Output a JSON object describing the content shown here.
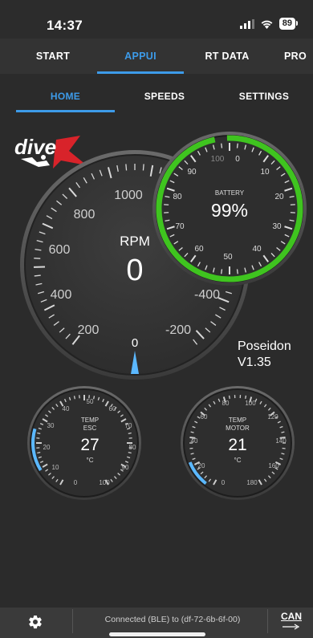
{
  "status": {
    "time": "14:37",
    "battery": "89"
  },
  "top_tabs": [
    {
      "label": "START",
      "active": false
    },
    {
      "label": "APPUI",
      "active": true
    },
    {
      "label": "RT DATA",
      "active": false
    },
    {
      "label": "PRO",
      "active": false
    }
  ],
  "sub_tabs": [
    {
      "label": "HOME",
      "active": true
    },
    {
      "label": "SPEEDS",
      "active": false
    },
    {
      "label": "SETTINGS",
      "active": false
    }
  ],
  "logo": {
    "text": "dive",
    "accent": "X"
  },
  "rpm_gauge": {
    "title": "RPM",
    "value": "0",
    "labels": [
      "1000",
      "800",
      "600",
      "400",
      "200",
      "0",
      "-200",
      "-400"
    ],
    "needle_color": "#5bb8ff"
  },
  "battery_gauge": {
    "title": "BATTERY",
    "value": "99%",
    "labels": [
      "100",
      "0",
      "10",
      "20",
      "30",
      "40",
      "50",
      "60",
      "70",
      "80",
      "90"
    ],
    "arc_color": "#3fc41f"
  },
  "esc_gauge": {
    "title_line1": "TEMP",
    "title_line2": "ESC",
    "value": "27",
    "unit": "°C",
    "labels": [
      "0",
      "10",
      "20",
      "30",
      "40",
      "50",
      "60",
      "70",
      "80",
      "90",
      "100"
    ]
  },
  "motor_gauge": {
    "title_line1": "TEMP",
    "title_line2": "MOTOR",
    "value": "21",
    "unit": "°C",
    "labels": [
      "0",
      "20",
      "40",
      "60",
      "80",
      "100",
      "120",
      "140",
      "160",
      "180"
    ]
  },
  "firmware": {
    "name": "Poseidon",
    "version": "V1.35"
  },
  "bottom_bar": {
    "connection": "Connected (BLE) to (df-72-6b-6f-00)",
    "can_label": "CAN"
  },
  "colors": {
    "accent": "#3d9be9",
    "battery_green": "#3fc41f",
    "temp_blue": "#5bb8ff"
  }
}
